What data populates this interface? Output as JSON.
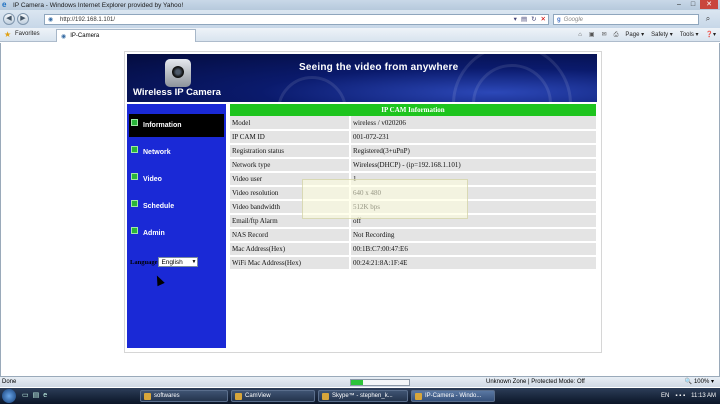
{
  "window": {
    "title": "IP Camera - Windows Internet Explorer provided by Yahoo!",
    "controls": [
      "–",
      "□",
      "✕"
    ]
  },
  "addressbar": {
    "url": "http://192.168.1.101/",
    "search_placeholder": "Google",
    "search_brand": "g"
  },
  "favbar": {
    "favorites_label": "Favorites",
    "tab_title": "IP-Camera",
    "commands": [
      "Page ▾",
      "Safety ▾",
      "Tools ▾",
      "❓▾"
    ]
  },
  "page": {
    "headline": "Seeing the video from anywhere",
    "brand": "Wireless IP Camera",
    "menu": [
      {
        "label": "Information",
        "active": true
      },
      {
        "label": "Network",
        "active": false
      },
      {
        "label": "Video",
        "active": false
      },
      {
        "label": "Schedule",
        "active": false
      },
      {
        "label": "Admin",
        "active": false
      }
    ],
    "language_label": "Language",
    "language_value": "English",
    "info_header": "IP CAM Information",
    "info_rows": [
      {
        "key": "Model",
        "value": "wireless / v020206"
      },
      {
        "key": "IP CAM ID",
        "value": "001-072-231"
      },
      {
        "key": "Registration status",
        "value": "Registered(3+uPnP)"
      },
      {
        "key": "Network type",
        "value": "Wireless(DHCP) - (ip=192.168.1.101)"
      },
      {
        "key": "Video user",
        "value": "1"
      },
      {
        "key": "Video resolution",
        "value": "640 x 480"
      },
      {
        "key": "Video bandwidth",
        "value": "512K bps"
      },
      {
        "key": "Email/ftp Alarm",
        "value": "off"
      },
      {
        "key": "NAS Record",
        "value": "Not Recording"
      },
      {
        "key": "Mac Address(Hex)",
        "value": "00:1B:C7:00:47:E6"
      },
      {
        "key": "WiFi Mac Address(Hex)",
        "value": "00:24:21:8A:1F:4E"
      }
    ]
  },
  "statusbar": {
    "status": "Done",
    "progress": 0.2,
    "zone": "Unknown Zone | Protected Mode: Off",
    "zoom": "🔍 100% ▾"
  },
  "taskbar": {
    "tasks": [
      "softwares",
      "CamView",
      "Skype™ - stephen_k...",
      "IP-Camera - Windo..."
    ],
    "tray_lang": "EN",
    "clock": "11:13 AM"
  },
  "colors": {
    "banner": "#0a1a6c",
    "sidebar": "#1a29d6",
    "header_green": "#1ec41e",
    "row_bg": "#e4e4e4"
  }
}
